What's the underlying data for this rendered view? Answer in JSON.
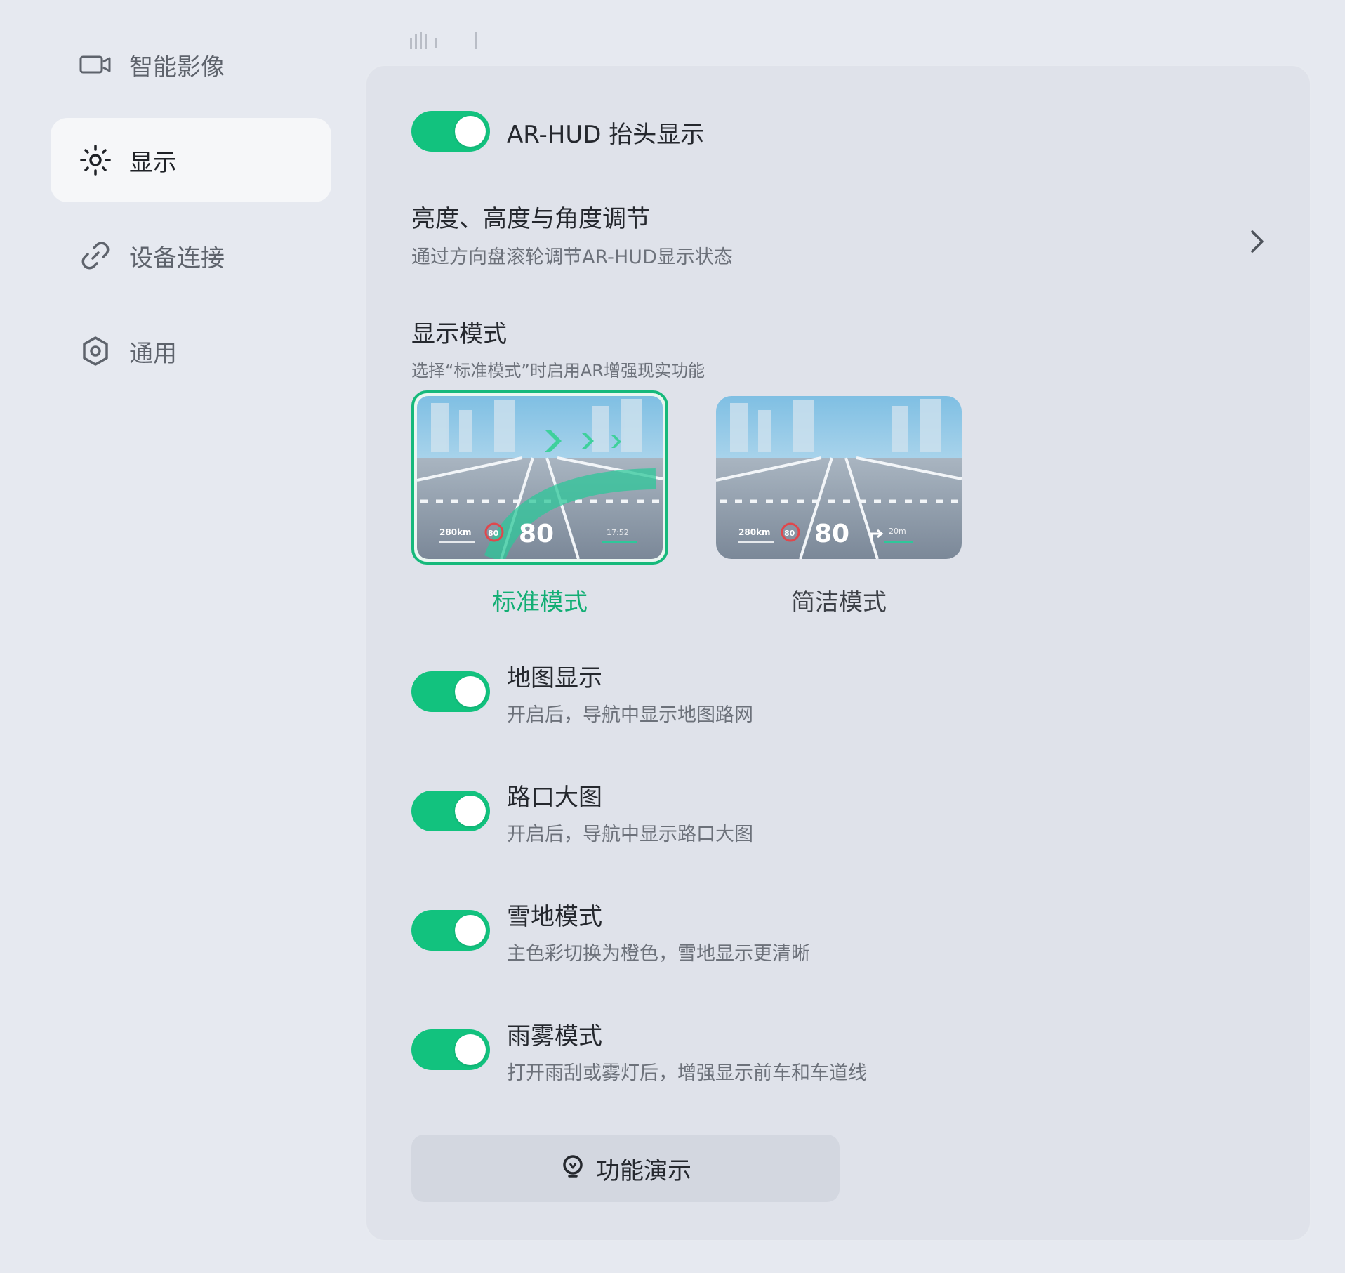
{
  "sidebar": {
    "items": [
      {
        "label": "智能影像",
        "icon": "camera-icon",
        "active": false
      },
      {
        "label": "显示",
        "icon": "sun-icon",
        "active": true
      },
      {
        "label": "设备连接",
        "icon": "link-icon",
        "active": false
      },
      {
        "label": "通用",
        "icon": "hexagon-settings-icon",
        "active": false
      }
    ]
  },
  "main": {
    "ar_hud": {
      "label": "AR-HUD 抬头显示",
      "enabled": true
    },
    "adjust": {
      "title": "亮度、高度与角度调节",
      "desc": "通过方向盘滚轮调节AR-HUD显示状态",
      "icon": "chevron-right-icon"
    },
    "display_mode": {
      "title": "显示模式",
      "desc": "选择“标准模式”时启用AR增强现实功能",
      "options": [
        {
          "label": "标准模式",
          "selected": true,
          "range": "280km",
          "limit": "80",
          "speed": "80",
          "time": "17:52",
          "distance": ""
        },
        {
          "label": "简洁模式",
          "selected": false,
          "range": "280km",
          "limit": "80",
          "speed": "80",
          "time": "",
          "distance": "20m"
        }
      ]
    },
    "toggles": [
      {
        "title": "地图显示",
        "desc": "开启后，导航中显示地图路网",
        "enabled": true
      },
      {
        "title": "路口大图",
        "desc": "开启后，导航中显示路口大图",
        "enabled": true
      },
      {
        "title": "雪地模式",
        "desc": "主色彩切换为橙色，雪地显示更清晰",
        "enabled": true
      },
      {
        "title": "雨雾模式",
        "desc": "打开雨刮或雾灯后，增强显示前车和车道线",
        "enabled": true
      }
    ],
    "demo_button": {
      "label": "功能演示",
      "icon": "lightbulb-icon"
    }
  },
  "colors": {
    "accent": "#12c27e",
    "selected_text": "#12ae74",
    "background": "#e6e9f0",
    "panel": "#dfe2ea"
  }
}
